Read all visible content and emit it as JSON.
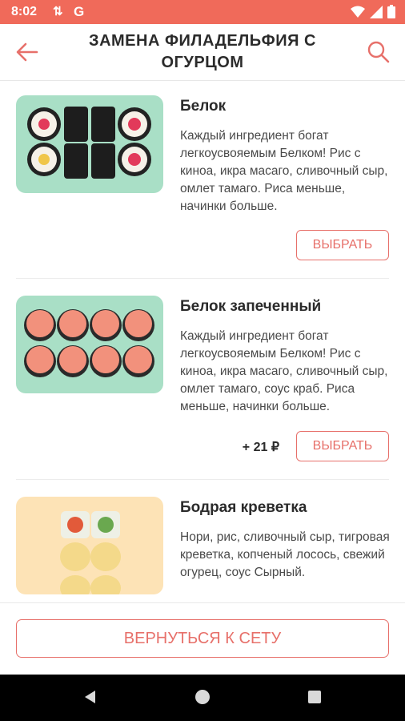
{
  "status_bar": {
    "time": "8:02",
    "sync_icon": "sync-arrows-icon",
    "g_letter": "G",
    "icons": [
      "wifi-icon",
      "signal-icon",
      "battery-icon"
    ]
  },
  "header": {
    "title": "ЗАМЕНА ФИЛАДЕЛЬФИЯ С ОГУРЦОМ",
    "back_icon": "arrow-left-icon",
    "search_icon": "search-icon"
  },
  "items": [
    {
      "title": "Белок",
      "description": "Каждый ингредиент богат легкоусвояемым Белком! Рис с киноа, икра масаго, сливочный сыр, омлет тамаго. Риса меньше, начинки больше.",
      "price": "",
      "button": "ВЫБРАТЬ",
      "image_bg": "#a9dfc6"
    },
    {
      "title": "Белок запеченный",
      "description": "Каждый ингредиент богат легкоусвояемым Белком! Рис с киноа, икра масаго, сливочный сыр, омлет тамаго, соус краб. Риса меньше, начинки больше.",
      "price": "+ 21 ₽",
      "button": "ВЫБРАТЬ",
      "image_bg": "#a9dfc6"
    },
    {
      "title": "Бодрая креветка",
      "description": "Нори, рис, сливочный сыр, тигровая креветка, копченый лосось, свежий огурец, соус Сырный.",
      "price": "",
      "button": "",
      "image_bg": "#fde3b6"
    }
  ],
  "bottom": {
    "return_button": "ВЕРНУТЬСЯ К СЕТУ"
  },
  "nav_bar": {
    "icons": [
      "back-triangle-icon",
      "home-circle-icon",
      "recents-square-icon"
    ]
  },
  "colors": {
    "accent": "#e7706a",
    "status_bar": "#f06a5a"
  }
}
